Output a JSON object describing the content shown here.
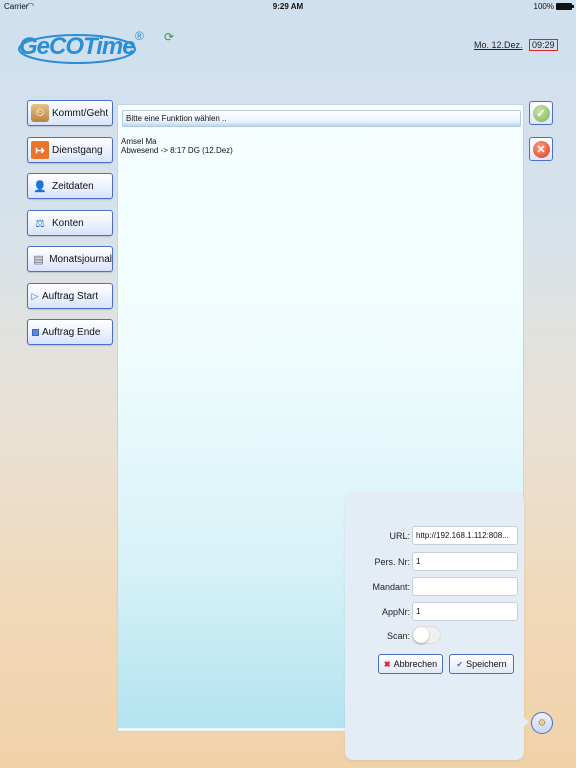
{
  "status_bar": {
    "carrier": "Carrier",
    "wifi_icon": "wifi-icon",
    "time": "9:29 AM",
    "battery_text": "100%",
    "battery_icon": "battery-icon"
  },
  "header": {
    "logo_text": "GeCOTime",
    "logo_reg": "®",
    "sync_icon": "sync-icon",
    "date": "Mo. 12.Dez.",
    "time": "09:29"
  },
  "sidebar": {
    "items": [
      {
        "label": "Kommt/Geht",
        "icon": "person-clock-icon"
      },
      {
        "label": "Dienstgang",
        "icon": "exit-icon"
      },
      {
        "label": "Zeitdaten",
        "icon": "person-info-icon"
      },
      {
        "label": "Konten",
        "icon": "scale-icon"
      },
      {
        "label": "Monatsjournal",
        "icon": "printer-icon"
      },
      {
        "label": "Auftrag Start",
        "icon": "play-icon"
      },
      {
        "label": "Auftrag Ende",
        "icon": "stop-icon"
      }
    ]
  },
  "main": {
    "function_prompt": "Bitte eine Funktion wählen ..",
    "user_name": "Amsel Ma",
    "user_status": "Abwesend -> 8:17 DG  (12.Dez)"
  },
  "actions": {
    "ok_icon": "checkmark-icon",
    "cancel_icon": "close-icon"
  },
  "settings_popover": {
    "url_label": "URL:",
    "url_value": "http://192.168.1.112:808...",
    "persnr_label": "Pers. Nr:",
    "persnr_value": "1",
    "mandant_label": "Mandant:",
    "mandant_value": "",
    "appnr_label": "AppNr:",
    "appnr_value": "1",
    "scan_label": "Scan:",
    "scan_enabled": false,
    "cancel_label": "Abbrechen",
    "save_label": "Speichern"
  },
  "settings_button_icon": "gear-icon"
}
